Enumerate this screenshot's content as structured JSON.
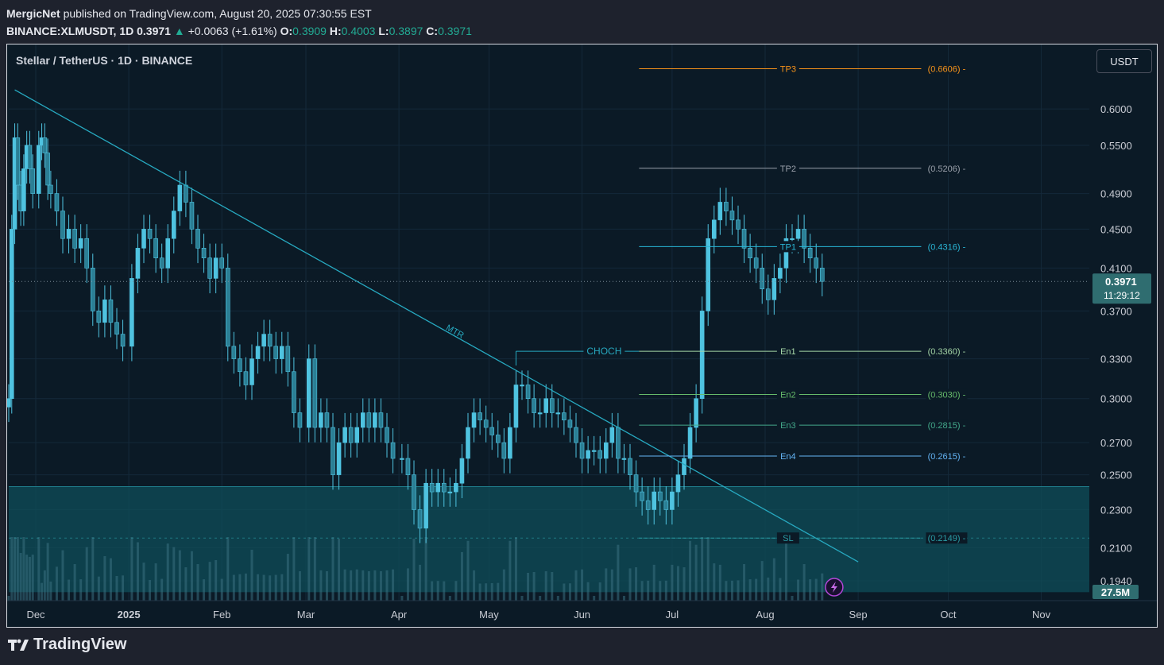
{
  "header": {
    "publisher": "MergicNet",
    "published_text": "published on TradingView.com, August 20, 2025 07:30:55 EST",
    "symbol": "BINANCE:XLMUSDT, 1D",
    "last": "0.3971",
    "change": "+0.0063 (+1.61%)",
    "o_label": "O:",
    "o": "0.3909",
    "h_label": "H:",
    "h": "0.4003",
    "l_label": "L:",
    "l": "0.3897",
    "c_label": "C:",
    "c": "0.3971"
  },
  "chart_title": "Stellar / TetherUS · 1D · BINANCE",
  "currency": "USDT",
  "footer": {
    "brand": "TradingView"
  },
  "colors": {
    "background": "#0b1a26",
    "candle": "#4fc3e0",
    "zone": "#0f4d5a",
    "trendline": "#27a9c0"
  },
  "chart_data": {
    "type": "candlestick",
    "y_scale": "log",
    "ylim": [
      0.185,
      0.7
    ],
    "xlim": [
      "2024-11-22",
      "2025-11-17"
    ],
    "y_ticks": [
      "0.6000",
      "0.5500",
      "0.4900",
      "0.4500",
      "0.4100",
      "0.3700",
      "0.3300",
      "0.3000",
      "0.2700",
      "0.2500",
      "0.2300",
      "0.2100",
      "0.1940"
    ],
    "x_ticks": [
      {
        "label": "Dec",
        "date": "2024-12-01"
      },
      {
        "label": "2025",
        "date": "2025-01-01"
      },
      {
        "label": "Feb",
        "date": "2025-02-01"
      },
      {
        "label": "Mar",
        "date": "2025-03-01"
      },
      {
        "label": "Apr",
        "date": "2025-04-01"
      },
      {
        "label": "May",
        "date": "2025-05-01"
      },
      {
        "label": "Jun",
        "date": "2025-06-01"
      },
      {
        "label": "Jul",
        "date": "2025-07-01"
      },
      {
        "label": "Aug",
        "date": "2025-08-01"
      },
      {
        "label": "Sep",
        "date": "2025-09-01"
      },
      {
        "label": "Oct",
        "date": "2025-10-01"
      },
      {
        "label": "Nov",
        "date": "2025-11-01"
      }
    ],
    "current_price": {
      "value": "0.3971",
      "countdown": "11:29:12"
    },
    "volume_label": "27.5M",
    "levels": [
      {
        "name": "TP3",
        "value": 0.6606,
        "label": "(0.6606)",
        "color": "#f7931a"
      },
      {
        "name": "TP2",
        "value": 0.5206,
        "label": "(0.5206)",
        "color": "#9aa0aa"
      },
      {
        "name": "TP1",
        "value": 0.4316,
        "label": "(0.4316)",
        "color": "#29b6d6"
      },
      {
        "name": "En1",
        "value": 0.336,
        "label": "(0.3360)",
        "color": "#a5d6a7"
      },
      {
        "name": "En2",
        "value": 0.303,
        "label": "(0.3030)",
        "color": "#66bb6a"
      },
      {
        "name": "En3",
        "value": 0.2815,
        "label": "(0.2815)",
        "color": "#43a88a"
      },
      {
        "name": "En4",
        "value": 0.2615,
        "label": "(0.2615)",
        "color": "#64b5f6"
      },
      {
        "name": "SL",
        "value": 0.2149,
        "label": "(0.2149)",
        "color": "#2a9da6"
      }
    ],
    "levels_start": "2025-06-20",
    "levels_end": "2025-09-22",
    "zone": {
      "from": 0.1888,
      "to": 0.243
    },
    "trendline": {
      "label": "MTR",
      "points": [
        [
          "2024-11-24",
          0.628
        ],
        [
          "2025-09-01",
          0.203
        ]
      ]
    },
    "choch": {
      "label": "CHOCH",
      "value": 0.336,
      "from": "2025-05-10",
      "to": "2025-06-20"
    },
    "closes": [
      [
        "2024-11-22",
        0.3
      ],
      [
        "2024-11-23",
        0.45
      ],
      [
        "2024-11-24",
        0.56
      ],
      [
        "2024-11-25",
        0.5
      ],
      [
        "2024-11-26",
        0.47
      ],
      [
        "2024-11-27",
        0.52
      ],
      [
        "2024-11-28",
        0.55
      ],
      [
        "2024-11-29",
        0.52
      ],
      [
        "2024-11-30",
        0.49
      ],
      [
        "2024-12-02",
        0.55
      ],
      [
        "2024-12-03",
        0.56
      ],
      [
        "2024-12-04",
        0.54
      ],
      [
        "2024-12-05",
        0.5
      ],
      [
        "2024-12-06",
        0.49
      ],
      [
        "2024-12-08",
        0.47
      ],
      [
        "2024-12-10",
        0.44
      ],
      [
        "2024-12-12",
        0.45
      ],
      [
        "2024-12-14",
        0.43
      ],
      [
        "2024-12-16",
        0.44
      ],
      [
        "2024-12-18",
        0.41
      ],
      [
        "2024-12-20",
        0.37
      ],
      [
        "2024-12-22",
        0.36
      ],
      [
        "2024-12-24",
        0.38
      ],
      [
        "2024-12-26",
        0.36
      ],
      [
        "2024-12-28",
        0.35
      ],
      [
        "2024-12-30",
        0.34
      ],
      [
        "2025-01-02",
        0.4
      ],
      [
        "2025-01-04",
        0.43
      ],
      [
        "2025-01-06",
        0.45
      ],
      [
        "2025-01-08",
        0.44
      ],
      [
        "2025-01-10",
        0.42
      ],
      [
        "2025-01-12",
        0.41
      ],
      [
        "2025-01-14",
        0.44
      ],
      [
        "2025-01-16",
        0.47
      ],
      [
        "2025-01-18",
        0.5
      ],
      [
        "2025-01-20",
        0.48
      ],
      [
        "2025-01-22",
        0.45
      ],
      [
        "2025-01-24",
        0.43
      ],
      [
        "2025-01-26",
        0.42
      ],
      [
        "2025-01-28",
        0.4
      ],
      [
        "2025-01-30",
        0.42
      ],
      [
        "2025-02-01",
        0.41
      ],
      [
        "2025-02-03",
        0.34
      ],
      [
        "2025-02-05",
        0.33
      ],
      [
        "2025-02-07",
        0.32
      ],
      [
        "2025-02-09",
        0.31
      ],
      [
        "2025-02-11",
        0.33
      ],
      [
        "2025-02-13",
        0.34
      ],
      [
        "2025-02-15",
        0.35
      ],
      [
        "2025-02-17",
        0.34
      ],
      [
        "2025-02-19",
        0.33
      ],
      [
        "2025-02-21",
        0.34
      ],
      [
        "2025-02-23",
        0.32
      ],
      [
        "2025-02-25",
        0.29
      ],
      [
        "2025-02-27",
        0.28
      ],
      [
        "2025-03-02",
        0.33
      ],
      [
        "2025-03-04",
        0.28
      ],
      [
        "2025-03-06",
        0.29
      ],
      [
        "2025-03-08",
        0.28
      ],
      [
        "2025-03-10",
        0.25
      ],
      [
        "2025-03-12",
        0.27
      ],
      [
        "2025-03-14",
        0.28
      ],
      [
        "2025-03-16",
        0.27
      ],
      [
        "2025-03-18",
        0.28
      ],
      [
        "2025-03-20",
        0.29
      ],
      [
        "2025-03-22",
        0.28
      ],
      [
        "2025-03-24",
        0.29
      ],
      [
        "2025-03-26",
        0.28
      ],
      [
        "2025-03-28",
        0.27
      ],
      [
        "2025-03-30",
        0.26
      ],
      [
        "2025-04-02",
        0.26
      ],
      [
        "2025-04-04",
        0.25
      ],
      [
        "2025-04-06",
        0.23
      ],
      [
        "2025-04-08",
        0.22
      ],
      [
        "2025-04-10",
        0.245
      ],
      [
        "2025-04-12",
        0.24
      ],
      [
        "2025-04-14",
        0.245
      ],
      [
        "2025-04-16",
        0.24
      ],
      [
        "2025-04-18",
        0.24
      ],
      [
        "2025-04-20",
        0.245
      ],
      [
        "2025-04-22",
        0.26
      ],
      [
        "2025-04-24",
        0.28
      ],
      [
        "2025-04-26",
        0.29
      ],
      [
        "2025-04-28",
        0.285
      ],
      [
        "2025-04-30",
        0.28
      ],
      [
        "2025-05-02",
        0.275
      ],
      [
        "2025-05-04",
        0.27
      ],
      [
        "2025-05-06",
        0.26
      ],
      [
        "2025-05-08",
        0.28
      ],
      [
        "2025-05-10",
        0.31
      ],
      [
        "2025-05-12",
        0.31
      ],
      [
        "2025-05-14",
        0.3
      ],
      [
        "2025-05-16",
        0.29
      ],
      [
        "2025-05-18",
        0.29
      ],
      [
        "2025-05-20",
        0.3
      ],
      [
        "2025-05-22",
        0.29
      ],
      [
        "2025-05-24",
        0.29
      ],
      [
        "2025-05-26",
        0.285
      ],
      [
        "2025-05-28",
        0.28
      ],
      [
        "2025-05-30",
        0.27
      ],
      [
        "2025-06-01",
        0.26
      ],
      [
        "2025-06-03",
        0.265
      ],
      [
        "2025-06-05",
        0.265
      ],
      [
        "2025-06-07",
        0.26
      ],
      [
        "2025-06-09",
        0.27
      ],
      [
        "2025-06-11",
        0.28
      ],
      [
        "2025-06-13",
        0.26
      ],
      [
        "2025-06-15",
        0.26
      ],
      [
        "2025-06-17",
        0.25
      ],
      [
        "2025-06-19",
        0.24
      ],
      [
        "2025-06-21",
        0.235
      ],
      [
        "2025-06-23",
        0.23
      ],
      [
        "2025-06-25",
        0.24
      ],
      [
        "2025-06-27",
        0.235
      ],
      [
        "2025-06-29",
        0.23
      ],
      [
        "2025-07-01",
        0.24
      ],
      [
        "2025-07-03",
        0.25
      ],
      [
        "2025-07-05",
        0.26
      ],
      [
        "2025-07-07",
        0.28
      ],
      [
        "2025-07-09",
        0.3
      ],
      [
        "2025-07-11",
        0.37
      ],
      [
        "2025-07-13",
        0.44
      ],
      [
        "2025-07-15",
        0.46
      ],
      [
        "2025-07-17",
        0.48
      ],
      [
        "2025-07-19",
        0.47
      ],
      [
        "2025-07-21",
        0.46
      ],
      [
        "2025-07-23",
        0.45
      ],
      [
        "2025-07-25",
        0.43
      ],
      [
        "2025-07-27",
        0.42
      ],
      [
        "2025-07-29",
        0.41
      ],
      [
        "2025-07-31",
        0.39
      ],
      [
        "2025-08-02",
        0.38
      ],
      [
        "2025-08-04",
        0.4
      ],
      [
        "2025-08-06",
        0.41
      ],
      [
        "2025-08-08",
        0.44
      ],
      [
        "2025-08-10",
        0.44
      ],
      [
        "2025-08-12",
        0.45
      ],
      [
        "2025-08-14",
        0.43
      ],
      [
        "2025-08-16",
        0.42
      ],
      [
        "2025-08-18",
        0.41
      ],
      [
        "2025-08-20",
        0.3971
      ]
    ]
  }
}
